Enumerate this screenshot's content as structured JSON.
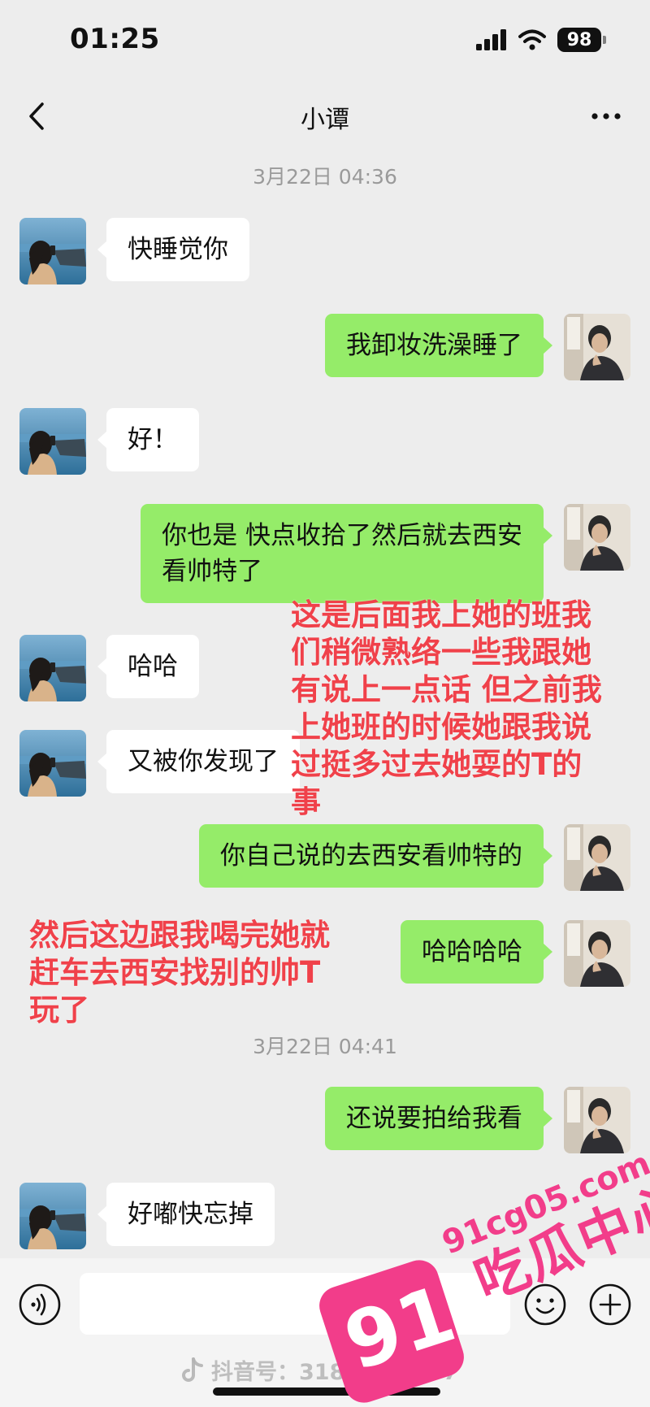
{
  "status_bar": {
    "time": "01:25",
    "battery": "98"
  },
  "header": {
    "title": "小谭"
  },
  "colors": {
    "background": "#ededed",
    "outgoing_bubble": "#95ec69",
    "incoming_bubble": "#ffffff",
    "annotation": "#f0414a",
    "brand": "#f23d8a"
  },
  "timestamps": [
    "3月22日 04:36",
    "3月22日 04:41"
  ],
  "messages": [
    {
      "side": "in",
      "text": "快睡觉你"
    },
    {
      "side": "out",
      "text": "我卸妆洗澡睡了"
    },
    {
      "side": "in",
      "text": "好！"
    },
    {
      "side": "out",
      "lines": [
        "你也是 快点收拾了然后就去西安",
        "看帅特了"
      ]
    },
    {
      "side": "in",
      "text": "哈哈"
    },
    {
      "side": "in",
      "text": "又被你发现了"
    },
    {
      "side": "out",
      "text": "你自己说的去西安看帅特的"
    },
    {
      "side": "out",
      "text": "哈哈哈哈"
    },
    {
      "side": "out",
      "text": "还说要拍给我看"
    },
    {
      "side": "in",
      "text": "好嘟快忘掉"
    }
  ],
  "annotations": {
    "first": [
      "这是后面我上她的班我",
      "们稍微熟络一些我跟她",
      "有说上一点话 但之前我",
      "上她班的时候她跟我说",
      "过挺多过去她耍的T的",
      "事"
    ],
    "second": [
      "然后这边跟我喝完她就",
      "赶车去西安找别的帅T",
      "玩了"
    ]
  },
  "watermarks": {
    "douyin": "抖音号：3180__88787",
    "brand_number": "91",
    "brand_url": "91cg05.com",
    "brand_name": "吃瓜中心"
  },
  "icons": {
    "back": "chevron-left-icon",
    "more": "more-dots-icon",
    "voice": "voice-icon",
    "emoji": "emoji-icon",
    "add": "plus-icon",
    "signal": "signal-icon",
    "wifi": "wifi-icon",
    "douyin": "douyin-logo-icon"
  }
}
